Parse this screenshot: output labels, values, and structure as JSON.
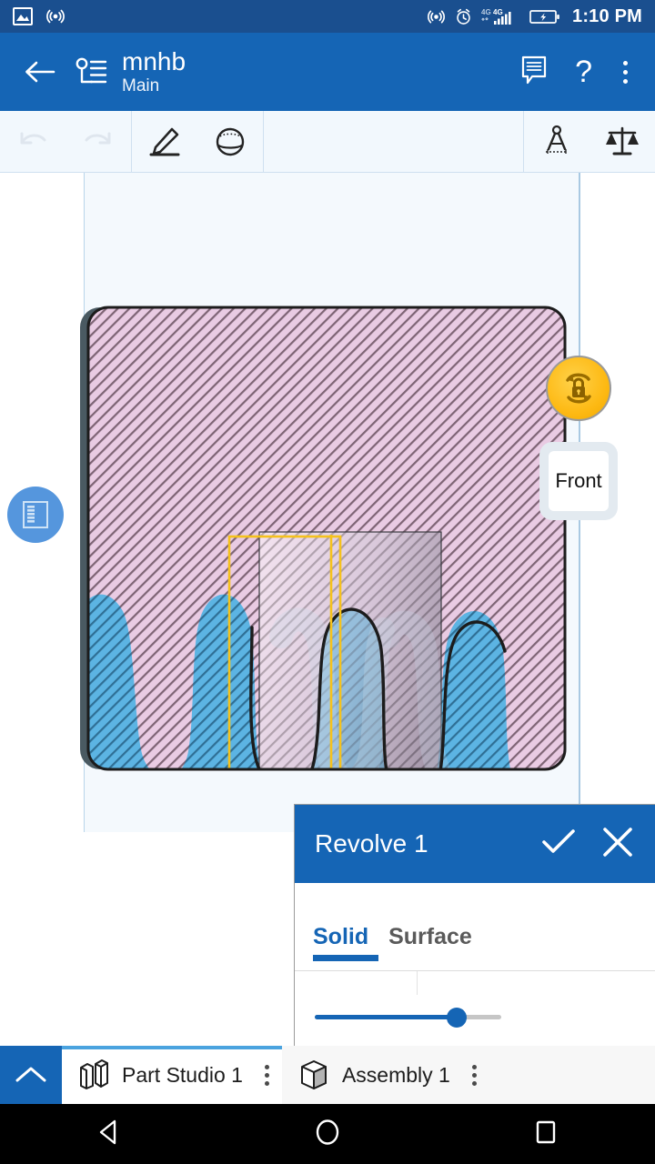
{
  "statusbar": {
    "time": "1:10 PM",
    "left_icons": [
      "screenshot-image-icon",
      "hotspot-icon"
    ],
    "right_icons": [
      "hotspot-icon",
      "alarm-clock-icon",
      "signal-4g-dual-icon",
      "battery-charging-icon"
    ],
    "network": "4G",
    "network2": "4G",
    "bg": "#1a4f8f"
  },
  "appbar": {
    "back_icon": "back-arrow-icon",
    "branch_icon": "branch-icon",
    "title": "mnhb",
    "subtitle": "Main",
    "comment_icon": "comment-icon",
    "help_label": "?",
    "overflow_icon": "overflow-menu-icon",
    "bg": "#1565b5"
  },
  "toolbar": {
    "undo_icon": "undo-icon",
    "redo_icon": "redo-icon",
    "sketch_icon": "sketch-pencil-icon",
    "revolve_icon": "revolve-icon",
    "measure_icon": "measure-compass-icon",
    "mass_icon": "mass-properties-scale-icon",
    "bg": "#f2f8fd"
  },
  "viewport": {
    "feature_list_icon": "feature-list-icon",
    "rotation_lock_icon": "rotation-lock-icon",
    "view_cube_label": "Front",
    "model_colors": {
      "pink_face": "#e8c9e2",
      "pink_hatch": "#7a6172",
      "blue_face": "#5cb4e3",
      "blue_hatch": "#2e6f96",
      "sketch_rect": "#f5c21c",
      "axis": "#f5c21c",
      "profile_overlay": "#8b8b96",
      "curve": "#1a1a1a"
    }
  },
  "dialog": {
    "title": "Revolve 1",
    "accept_icon": "checkmark-icon",
    "cancel_icon": "close-icon",
    "tabs": [
      {
        "label": "Solid",
        "active": true
      },
      {
        "label": "Surface",
        "active": false
      }
    ],
    "slider": {
      "value_percent": 75
    },
    "accent": "#1565b5"
  },
  "bottom_tabs": {
    "collapse_icon": "chevron-up-icon",
    "items": [
      {
        "label": "Part Studio 1",
        "icon": "part-studio-icon",
        "active": true,
        "overflow_icon": "overflow-menu-icon"
      },
      {
        "label": "Assembly 1",
        "icon": "assembly-icon",
        "active": false,
        "overflow_icon": "overflow-menu-icon"
      }
    ]
  },
  "navbar": {
    "back_icon": "nav-back-triangle-icon",
    "home_icon": "nav-home-circle-icon",
    "recents_icon": "nav-recents-square-icon"
  }
}
